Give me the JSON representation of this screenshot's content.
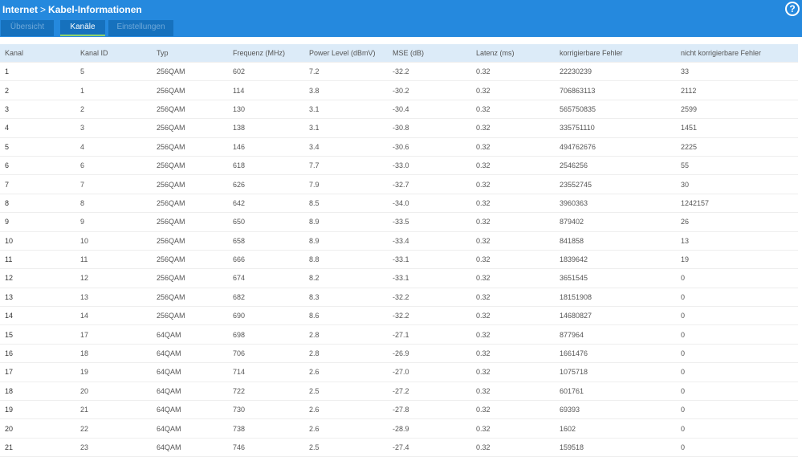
{
  "header": {
    "breadcrumb": [
      "Internet",
      "Kabel-Informationen"
    ],
    "separator": ">",
    "help": "?"
  },
  "tabs": [
    {
      "label": "Übersicht"
    },
    {
      "label": "Kanäle",
      "active": true
    },
    {
      "label": "Einstellungen"
    }
  ],
  "table": {
    "columns": [
      "Kanal",
      "Kanal ID",
      "Typ",
      "Frequenz (MHz)",
      "Power Level (dBmV)",
      "MSE (dB)",
      "Latenz (ms)",
      "korrigierbare Fehler",
      "nicht korrigierbare Fehler"
    ],
    "rows": [
      [
        "1",
        "5",
        "256QAM",
        "602",
        "7.2",
        "-32.2",
        "0.32",
        "22230239",
        "33"
      ],
      [
        "2",
        "1",
        "256QAM",
        "114",
        "3.8",
        "-30.2",
        "0.32",
        "706863113",
        "2112"
      ],
      [
        "3",
        "2",
        "256QAM",
        "130",
        "3.1",
        "-30.4",
        "0.32",
        "565750835",
        "2599"
      ],
      [
        "4",
        "3",
        "256QAM",
        "138",
        "3.1",
        "-30.8",
        "0.32",
        "335751110",
        "1451"
      ],
      [
        "5",
        "4",
        "256QAM",
        "146",
        "3.4",
        "-30.6",
        "0.32",
        "494762676",
        "2225"
      ],
      [
        "6",
        "6",
        "256QAM",
        "618",
        "7.7",
        "-33.0",
        "0.32",
        "2546256",
        "55"
      ],
      [
        "7",
        "7",
        "256QAM",
        "626",
        "7.9",
        "-32.7",
        "0.32",
        "23552745",
        "30"
      ],
      [
        "8",
        "8",
        "256QAM",
        "642",
        "8.5",
        "-34.0",
        "0.32",
        "3960363",
        "1242157"
      ],
      [
        "9",
        "9",
        "256QAM",
        "650",
        "8.9",
        "-33.5",
        "0.32",
        "879402",
        "26"
      ],
      [
        "10",
        "10",
        "256QAM",
        "658",
        "8.9",
        "-33.4",
        "0.32",
        "841858",
        "13"
      ],
      [
        "11",
        "11",
        "256QAM",
        "666",
        "8.8",
        "-33.1",
        "0.32",
        "1839642",
        "19"
      ],
      [
        "12",
        "12",
        "256QAM",
        "674",
        "8.2",
        "-33.1",
        "0.32",
        "3651545",
        "0"
      ],
      [
        "13",
        "13",
        "256QAM",
        "682",
        "8.3",
        "-32.2",
        "0.32",
        "18151908",
        "0"
      ],
      [
        "14",
        "14",
        "256QAM",
        "690",
        "8.6",
        "-32.2",
        "0.32",
        "14680827",
        "0"
      ],
      [
        "15",
        "17",
        "64QAM",
        "698",
        "2.8",
        "-27.1",
        "0.32",
        "877964",
        "0"
      ],
      [
        "16",
        "18",
        "64QAM",
        "706",
        "2.8",
        "-26.9",
        "0.32",
        "1661476",
        "0"
      ],
      [
        "17",
        "19",
        "64QAM",
        "714",
        "2.6",
        "-27.0",
        "0.32",
        "1075718",
        "0"
      ],
      [
        "18",
        "20",
        "64QAM",
        "722",
        "2.5",
        "-27.2",
        "0.32",
        "601761",
        "0"
      ],
      [
        "19",
        "21",
        "64QAM",
        "730",
        "2.6",
        "-27.8",
        "0.32",
        "69393",
        "0"
      ],
      [
        "20",
        "22",
        "64QAM",
        "738",
        "2.6",
        "-28.9",
        "0.32",
        "1602",
        "0"
      ],
      [
        "21",
        "23",
        "64QAM",
        "746",
        "2.5",
        "-27.4",
        "0.32",
        "159518",
        "0"
      ]
    ]
  }
}
